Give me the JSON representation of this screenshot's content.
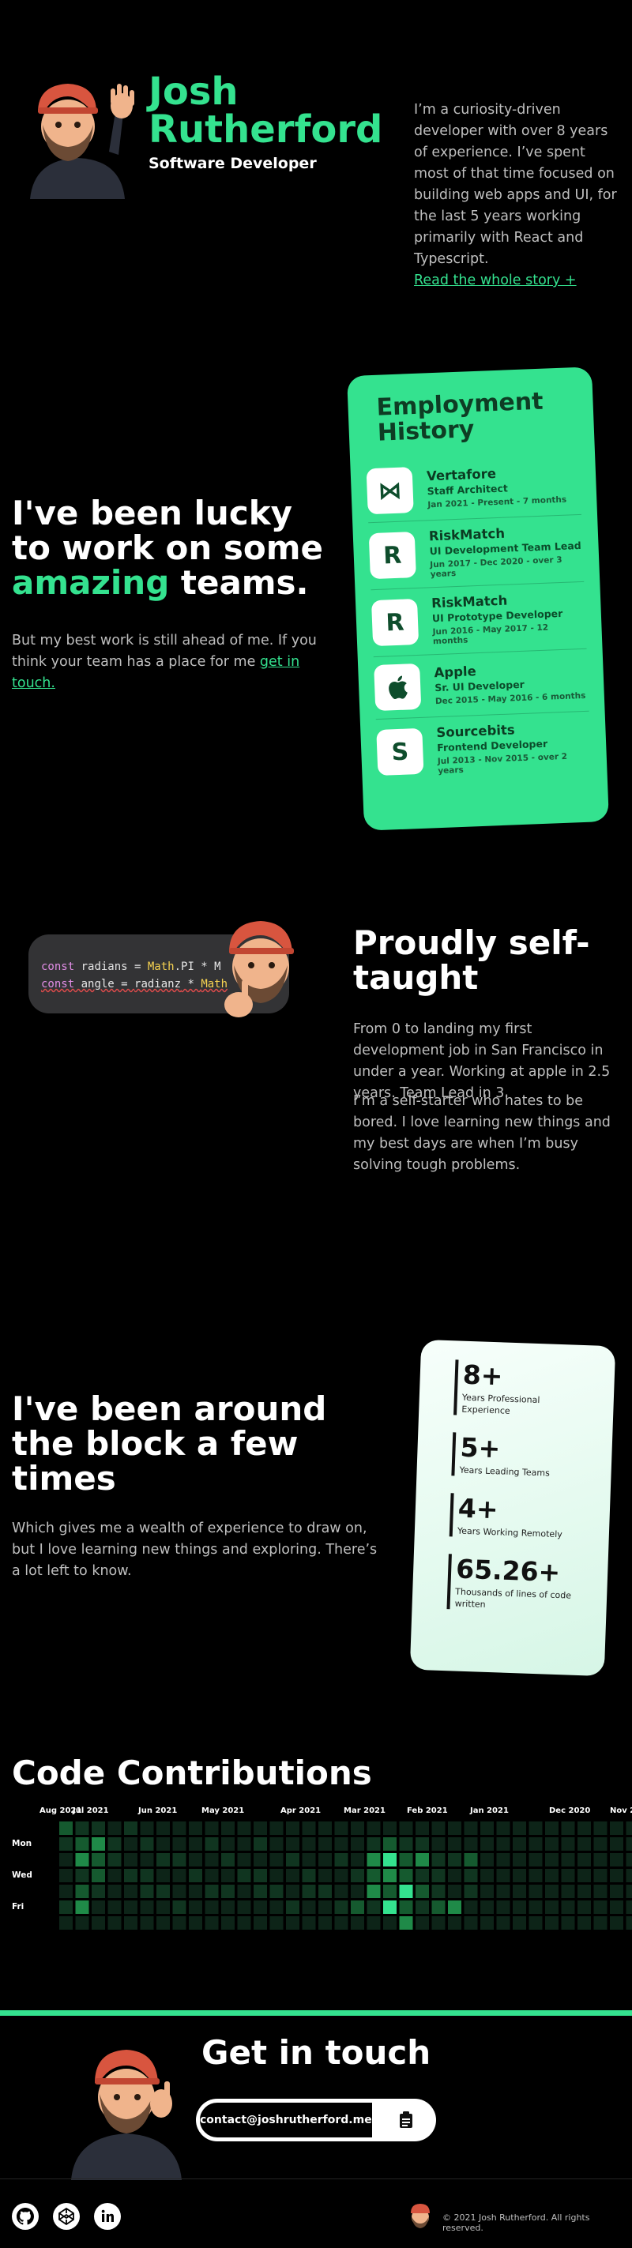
{
  "hero": {
    "first_name": "Josh",
    "last_name": "Rutherford",
    "role": "Software Developer",
    "bio": "I’m a curiosity-driven developer with over 8 years of experience. I’ve spent most of that time focused on building web apps and UI, for the last 5 years working primarily with React and Typescript.",
    "story_link": "Read the whole story +"
  },
  "teams": {
    "head_line1": "I've been lucky",
    "head_line2": "to work on some",
    "head_highlight": "amazing",
    "head_tail": " teams.",
    "sub_text": "But my best work is still ahead of me. If you think your team has a place for me ",
    "sub_link": "get in touch."
  },
  "employment": {
    "title": "Employment History",
    "jobs": [
      {
        "company": "Vertafore",
        "role": "Staff Architect",
        "dates": "Jan 2021 - Present - 7 months",
        "logo": "vertafore-logo"
      },
      {
        "company": "RiskMatch",
        "role": "UI Development Team Lead",
        "dates": "Jun 2017 - Dec 2020 - over 3 years",
        "logo": "riskmatch-logo"
      },
      {
        "company": "RiskMatch",
        "role": "UI Prototype Developer",
        "dates": "Jun 2016 - May 2017 - 12 months",
        "logo": "riskmatch-logo"
      },
      {
        "company": "Apple",
        "role": "Sr. UI Developer",
        "dates": "Dec 2015 - May 2016 - 6 months",
        "logo": "apple-logo"
      },
      {
        "company": "Sourcebits",
        "role": "Frontend Developer",
        "dates": "Jul 2013 - Nov 2015 - over 2 years",
        "logo": "sourcebits-logo"
      }
    ]
  },
  "code_snippet": {
    "line1_kw": "const",
    "line1_var": " radians = ",
    "line1_cls": "Math",
    "line1_rest": ".PI * M",
    "line2_kw": "const",
    "line2_var": " angle = ",
    "line2_err": "radianz",
    "line2_mid": " * ",
    "line2_cls": "Math"
  },
  "taught": {
    "title": "Proudly self-taught",
    "p1": "From 0 to landing my first development job in San Francisco in under a year. Working at apple in 2.5 years. Team Lead in 3.",
    "p2": "I’m a self-starter who hates to be bored. I love learning new things and my best days are when I’m busy solving tough problems."
  },
  "block": {
    "title": "I've been around the block a few times",
    "sub": "Which gives me a wealth of experience to draw on, but I love learning new things and exploring. There’s a lot left to know."
  },
  "stats": [
    {
      "value": "8+",
      "label": "Years Professional Experience"
    },
    {
      "value": "5+",
      "label": "Years Leading Teams"
    },
    {
      "value": "4+",
      "label": "Years Working Remotely"
    },
    {
      "value": "65.26+",
      "label": "Thousands of lines of code written"
    }
  ],
  "contributions": {
    "title": "Code Contributions",
    "months": [
      "Aug 2021",
      "Jul 2021",
      "Jun 2021",
      "May 2021",
      "Apr 2021",
      "Mar 2021",
      "Feb 2021",
      "Jan 2021",
      "Dec 2020",
      "Nov 2"
    ],
    "days": [
      "Mon",
      "Wed",
      "Fri"
    ],
    "colors": [
      "#0d2418",
      "#103520",
      "#155a2f",
      "#1f8a48",
      "#34e28f"
    ],
    "levels": [
      [
        2,
        1,
        1,
        0,
        1,
        0,
        0,
        0,
        0,
        0,
        0,
        0,
        0,
        0,
        0,
        0,
        0,
        0,
        0,
        0,
        0,
        0,
        0,
        0,
        0,
        0,
        0,
        0,
        0,
        0,
        0,
        0,
        0,
        0,
        0,
        0,
        0,
        0,
        0,
        0,
        0,
        0,
        0
      ],
      [
        1,
        2,
        3,
        1,
        0,
        1,
        0,
        0,
        0,
        1,
        0,
        0,
        1,
        0,
        0,
        0,
        0,
        0,
        0,
        1,
        2,
        1,
        1,
        0,
        0,
        0,
        0,
        0,
        0,
        0,
        0,
        0,
        0,
        0,
        0,
        0,
        0,
        0,
        0,
        0,
        0,
        0,
        0
      ],
      [
        0,
        3,
        2,
        1,
        0,
        0,
        1,
        1,
        0,
        0,
        1,
        0,
        0,
        0,
        1,
        0,
        0,
        1,
        0,
        3,
        4,
        2,
        3,
        1,
        1,
        2,
        0,
        0,
        0,
        0,
        0,
        0,
        0,
        0,
        0,
        0,
        0,
        0,
        0,
        0,
        0,
        0,
        0
      ],
      [
        0,
        1,
        2,
        0,
        1,
        1,
        0,
        0,
        1,
        0,
        0,
        1,
        1,
        0,
        0,
        1,
        0,
        0,
        1,
        2,
        3,
        2,
        1,
        1,
        0,
        1,
        0,
        0,
        0,
        0,
        0,
        0,
        0,
        0,
        0,
        0,
        0,
        0,
        0,
        0,
        0,
        0,
        0
      ],
      [
        0,
        2,
        1,
        0,
        0,
        1,
        1,
        0,
        0,
        1,
        1,
        0,
        1,
        1,
        0,
        1,
        1,
        0,
        0,
        3,
        2,
        4,
        2,
        1,
        0,
        1,
        0,
        0,
        0,
        0,
        0,
        0,
        0,
        0,
        0,
        0,
        0,
        0,
        0,
        0,
        0,
        0,
        0
      ],
      [
        1,
        3,
        0,
        0,
        0,
        0,
        0,
        1,
        0,
        0,
        0,
        0,
        0,
        0,
        1,
        0,
        0,
        1,
        2,
        1,
        4,
        2,
        1,
        2,
        3,
        0,
        0,
        0,
        0,
        0,
        0,
        0,
        0,
        0,
        0,
        0,
        0,
        0,
        0,
        0,
        0,
        0,
        0
      ],
      [
        0,
        0,
        0,
        0,
        0,
        0,
        0,
        0,
        0,
        0,
        0,
        0,
        0,
        0,
        0,
        0,
        0,
        0,
        0,
        0,
        0,
        3,
        0,
        0,
        0,
        0,
        0,
        0,
        0,
        0,
        0,
        0,
        0,
        0,
        0,
        0,
        0,
        0,
        0,
        0,
        0,
        0,
        0
      ]
    ]
  },
  "contact": {
    "title": "Get in touch",
    "email": "contact@joshrutherford.me",
    "copy_icon": "clipboard-icon"
  },
  "footer": {
    "socials": [
      "github-icon",
      "codepen-icon",
      "linkedin-icon"
    ],
    "copyright": "© 2021 Josh Rutherford. All rights reserved."
  },
  "theme": {
    "accent": "#34e28f",
    "background": "#000000"
  }
}
